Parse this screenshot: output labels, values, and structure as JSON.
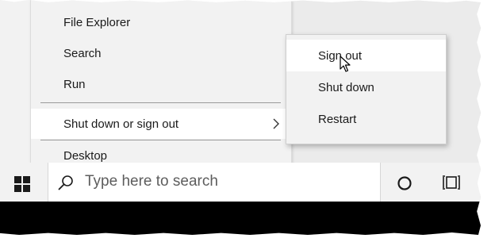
{
  "start_menu": {
    "items": [
      {
        "label": "File Explorer"
      },
      {
        "label": "Search"
      },
      {
        "label": "Run"
      },
      {
        "label": "Shut down or sign out"
      },
      {
        "label": "Desktop"
      }
    ]
  },
  "power_submenu": {
    "items": [
      {
        "label": "Sign out"
      },
      {
        "label": "Shut down"
      },
      {
        "label": "Restart"
      }
    ]
  },
  "taskbar": {
    "search_placeholder": "Type here to search",
    "icons": [
      "windows-logo-icon",
      "search-icon",
      "cortana-icon",
      "task-view-icon"
    ]
  },
  "colors": {
    "menu_bg": "#f2f2f2",
    "highlight_bg": "#ffffff",
    "text": "#1a1a1a"
  }
}
